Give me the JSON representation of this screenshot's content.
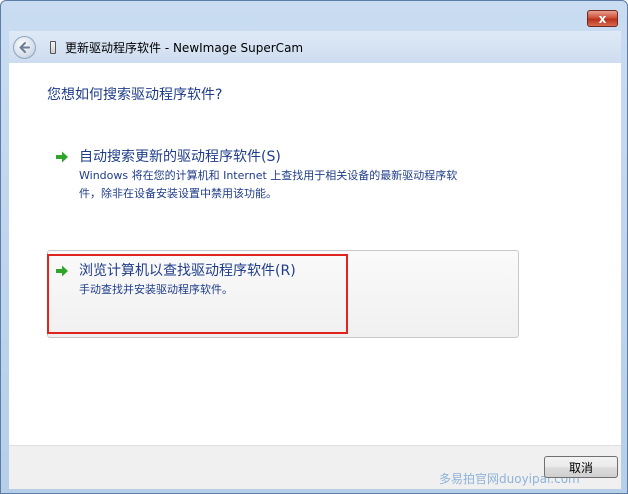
{
  "window": {
    "close_label": "x",
    "header_title": "更新驱动程序软件 - NewImage SuperCam"
  },
  "content": {
    "question": "您想如何搜索驱动程序软件?",
    "options": [
      {
        "title": "自动搜索更新的驱动程序软件(S)",
        "desc_line1": "Windows 将在您的计算机和 Internet 上查找用于相关设备的最新驱动程序软",
        "desc_line2": "件，除非在设备安装设置中禁用该功能。"
      },
      {
        "title": "浏览计算机以查找驱动程序软件(R)",
        "desc_line1": "手动查找并安装驱动程序软件。"
      }
    ]
  },
  "footer": {
    "cancel_label": "取消",
    "watermark": "多易拍官网duoyipai.com"
  },
  "colors": {
    "link_blue": "#1f3d8a",
    "arrow_green": "#2fa52a",
    "highlight_red": "#e0241f"
  }
}
